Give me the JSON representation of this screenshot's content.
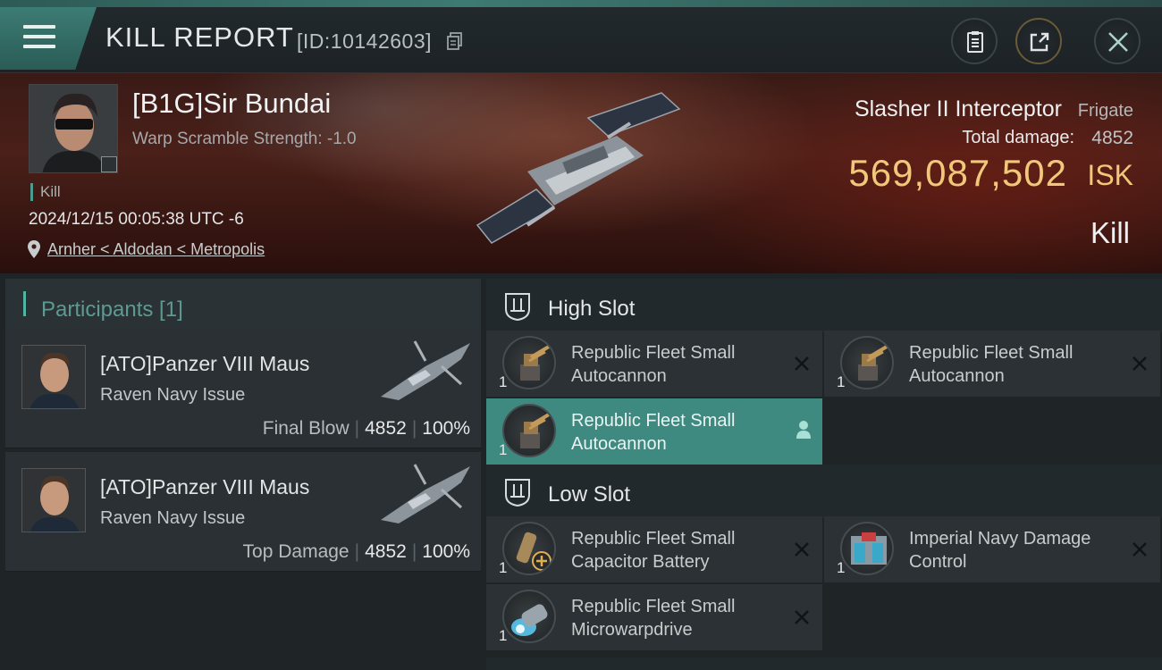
{
  "header": {
    "title": "KILL REPORT",
    "id_text": "[ID:10142603]",
    "icons": [
      "menu-icon",
      "copy-icon",
      "clipboard-icon",
      "share-icon",
      "close-icon"
    ]
  },
  "victim": {
    "name": "[B1G]Sir Bundai",
    "scramble": "Warp Scramble Strength: -1.0",
    "kill_tag": "Kill",
    "timestamp": "2024/12/15 00:05:38 UTC -6",
    "location": "Arnher < Aldodan < Metropolis",
    "ship_name": "Slasher II Interceptor",
    "ship_class": "Frigate",
    "damage_label": "Total damage:",
    "damage_value": "4852",
    "isk_value": "569,087,502",
    "isk_unit": "ISK",
    "result": "Kill"
  },
  "participants": {
    "header": "Participants [1]",
    "rows": [
      {
        "name": "[ATO]Panzer VIII Maus",
        "ship": "Raven Navy Issue",
        "label": "Final Blow",
        "damage": "4852",
        "percent": "100%"
      },
      {
        "name": "[ATO]Panzer VIII Maus",
        "ship": "Raven Navy Issue",
        "label": "Top Damage",
        "damage": "4852",
        "percent": "100%"
      }
    ]
  },
  "fitting": {
    "high_slot": {
      "title": "High Slot",
      "modules": [
        {
          "name": "Republic Fleet Small Autocannon",
          "qty": "1"
        },
        {
          "name": "Republic Fleet Small Autocannon",
          "qty": "1"
        },
        {
          "name": "Republic Fleet Small Autocannon",
          "qty": "1"
        }
      ]
    },
    "low_slot": {
      "title": "Low Slot",
      "modules": [
        {
          "name": "Republic Fleet Small Capacitor Battery",
          "qty": "1"
        },
        {
          "name": "Imperial Navy Damage Control",
          "qty": "1"
        },
        {
          "name": "Republic Fleet Small Microwarpdrive",
          "qty": "1"
        }
      ]
    }
  },
  "colors": {
    "accent": "#4fb3a5",
    "isk_gold": "#f1c87a",
    "active_module": "#3f8a80"
  }
}
